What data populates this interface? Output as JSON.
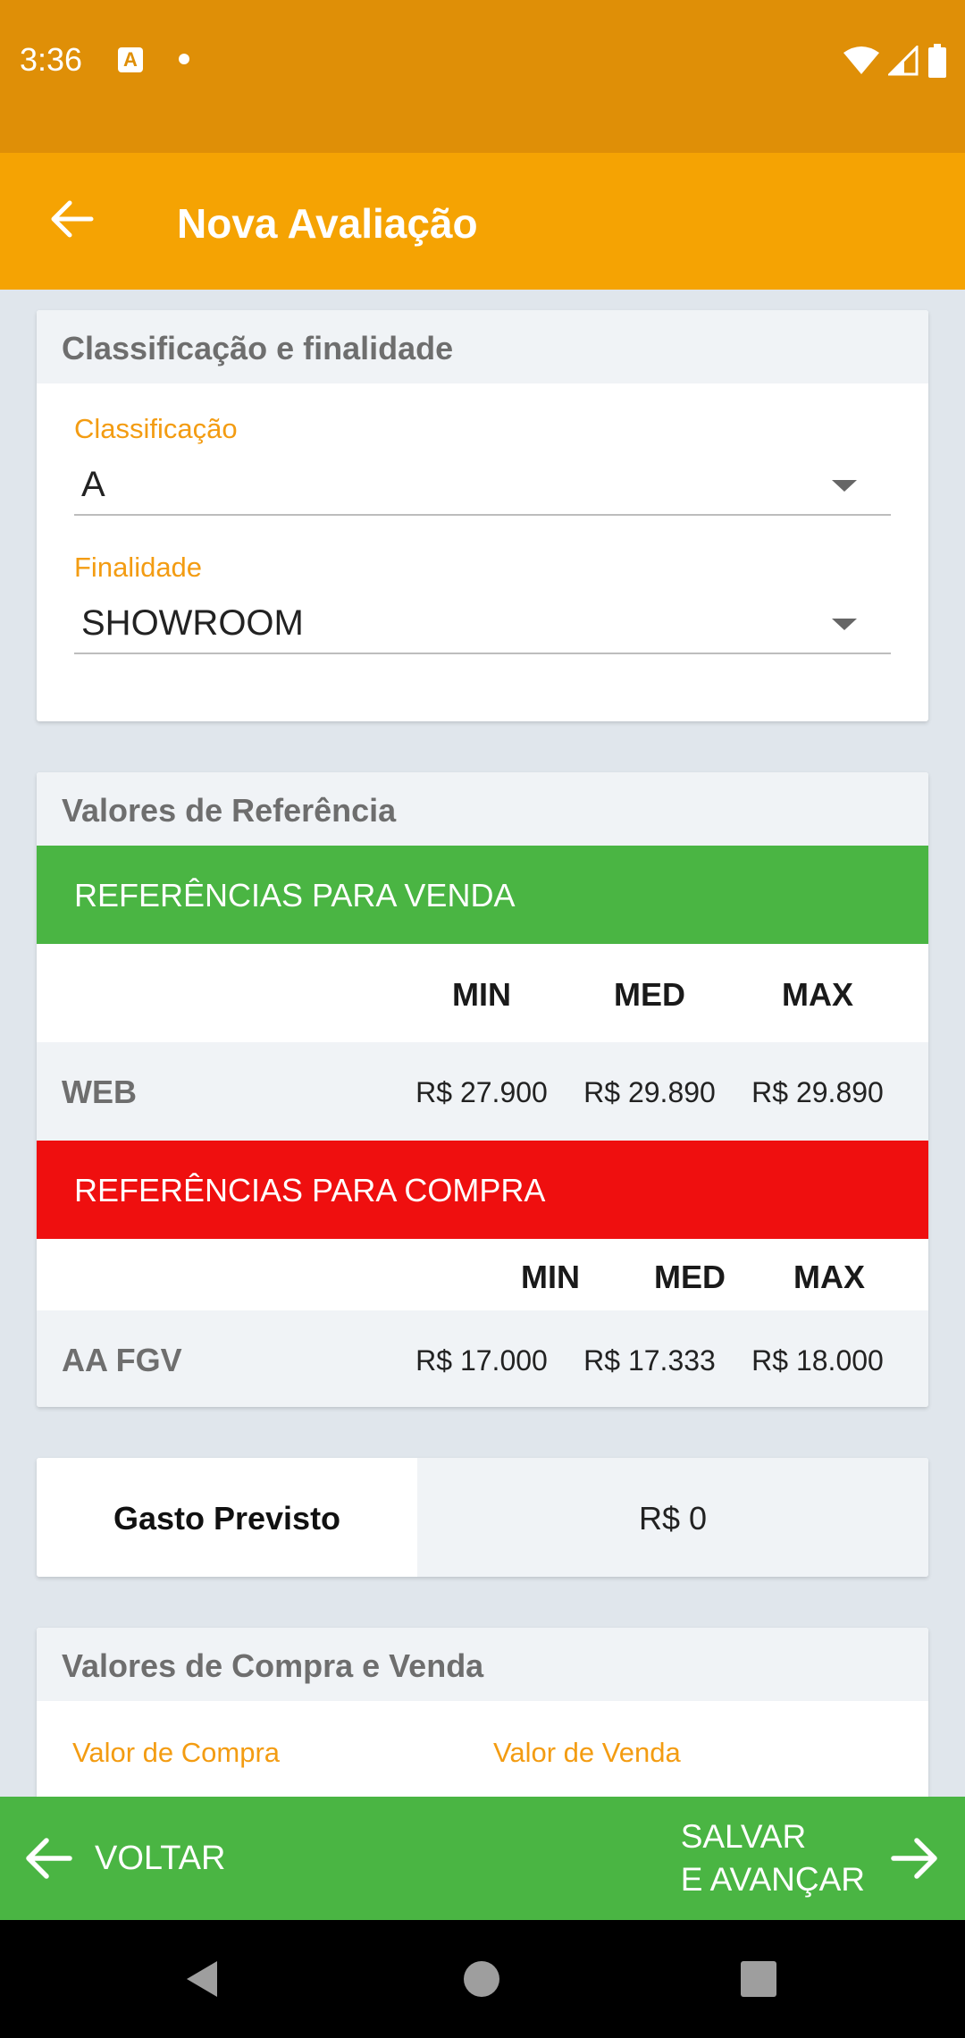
{
  "status_bar": {
    "time": "3:36",
    "notification_icon": "A"
  },
  "app_bar": {
    "title": "Nova Avaliação",
    "back_icon": "arrow-left"
  },
  "classificacao_card": {
    "header": "Classificação e finalidade",
    "classificacao": {
      "label": "Classificação",
      "value": "A"
    },
    "finalidade": {
      "label": "Finalidade",
      "value": "SHOWROOM"
    }
  },
  "referencia_card": {
    "header": "Valores de Referência",
    "venda": {
      "title": "REFERÊNCIAS PARA VENDA",
      "color": "#4ab543",
      "columns": [
        "MIN",
        "MED",
        "MAX"
      ],
      "row": {
        "label": "WEB",
        "values": [
          "R$  27.900",
          "R$  29.890",
          "R$  29.890"
        ]
      }
    },
    "compra": {
      "title": "REFERÊNCIAS PARA COMPRA",
      "color": "#ef0f0f",
      "columns": [
        "MIN",
        "MED",
        "MAX"
      ],
      "row": {
        "label": "AA FGV",
        "values": [
          "R$  17.000",
          "R$  17.333",
          "R$  18.000"
        ]
      }
    }
  },
  "gasto_card": {
    "label": "Gasto Previsto",
    "value": "R$  0"
  },
  "compra_venda_card": {
    "header": "Valores de Compra e Venda",
    "compra_label": "Valor de Compra",
    "venda_label": "Valor de Venda"
  },
  "action_bar": {
    "back_label": "VOLTAR",
    "save_line1": "SALVAR",
    "save_line2": "E AVANÇAR"
  }
}
